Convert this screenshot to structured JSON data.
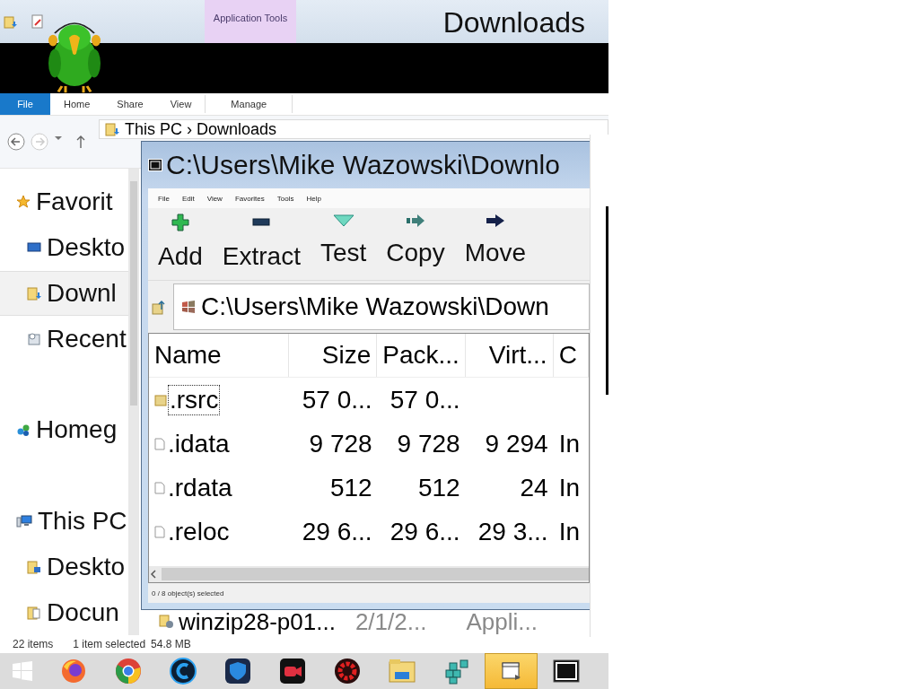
{
  "explorer": {
    "title": "Downloads",
    "context_tab": "Application Tools",
    "ribbon_tabs": [
      {
        "label": "File",
        "selected": true
      },
      {
        "label": "Home",
        "selected": false
      },
      {
        "label": "Share",
        "selected": false
      },
      {
        "label": "View",
        "selected": false
      },
      {
        "label": "Manage",
        "selected": false
      }
    ],
    "address": "This PC › Downloads",
    "nav_tree": [
      {
        "label": "Favorit",
        "kind": "star",
        "selected": false,
        "children": [
          {
            "label": "Deskto",
            "kind": "desktop",
            "selected": false
          },
          {
            "label": "Downl",
            "kind": "downloads",
            "selected": true
          },
          {
            "label": "Recent",
            "kind": "recent",
            "selected": false
          }
        ]
      },
      {
        "label": "Homeg",
        "kind": "homegroup",
        "selected": false
      },
      {
        "label": "This PC",
        "kind": "computer",
        "selected": false,
        "children": [
          {
            "label": "Deskto",
            "kind": "desktop-folder",
            "selected": false
          },
          {
            "label": "Docun",
            "kind": "documents",
            "selected": false
          }
        ]
      }
    ],
    "partial_row": {
      "name": "winzip28-p01...",
      "date": "2/1/2...",
      "type": "Appli..."
    },
    "status": [
      "22 items",
      "1 item selected",
      "54.8 MB"
    ]
  },
  "archive_window": {
    "title": "C:\\Users\\Mike Wazowski\\Downlo",
    "menu": [
      "File",
      "Edit",
      "View",
      "Favorites",
      "Tools",
      "Help"
    ],
    "toolbar": [
      {
        "label": "Add",
        "kind": "add"
      },
      {
        "label": "Extract",
        "kind": "extract"
      },
      {
        "label": "Test",
        "kind": "test"
      },
      {
        "label": "Copy",
        "kind": "copy"
      },
      {
        "label": "Move",
        "kind": "move"
      }
    ],
    "address": "C:\\Users\\Mike Wazowski\\Down",
    "columns": [
      "Name",
      "Size",
      "Pack...",
      "Virt...",
      "C"
    ],
    "rows": [
      {
        "kind": "folder",
        "focused": true,
        "name": ".rsrc",
        "size": "57 0...",
        "packed": "57 0..."
      },
      {
        "kind": "file",
        "focused": false,
        "name": ".idata",
        "size": "9 728",
        "packed": "9 728",
        "virtual": "9 294",
        "column_5": "In"
      },
      {
        "kind": "file",
        "focused": false,
        "name": ".rdata",
        "size": "512",
        "packed": "512",
        "virtual": "24",
        "column_5": "In"
      },
      {
        "kind": "file",
        "focused": false,
        "name": ".reloc",
        "size": "29 6...",
        "packed": "29 6...",
        "virtual": "29 3...",
        "column_5": "In"
      }
    ],
    "status": "0 / 8 object(s) selected"
  },
  "taskbar": [
    {
      "kind": "start",
      "selected": false
    },
    {
      "kind": "firefox",
      "selected": false
    },
    {
      "kind": "chrome",
      "selected": false
    },
    {
      "kind": "cleaner",
      "selected": false
    },
    {
      "kind": "shield",
      "selected": false
    },
    {
      "kind": "recorder",
      "selected": false
    },
    {
      "kind": "gear",
      "selected": false
    },
    {
      "kind": "explorer",
      "selected": false
    },
    {
      "kind": "cubes",
      "selected": false
    },
    {
      "kind": "window",
      "selected": true
    },
    {
      "kind": "archiver",
      "selected": false
    }
  ]
}
